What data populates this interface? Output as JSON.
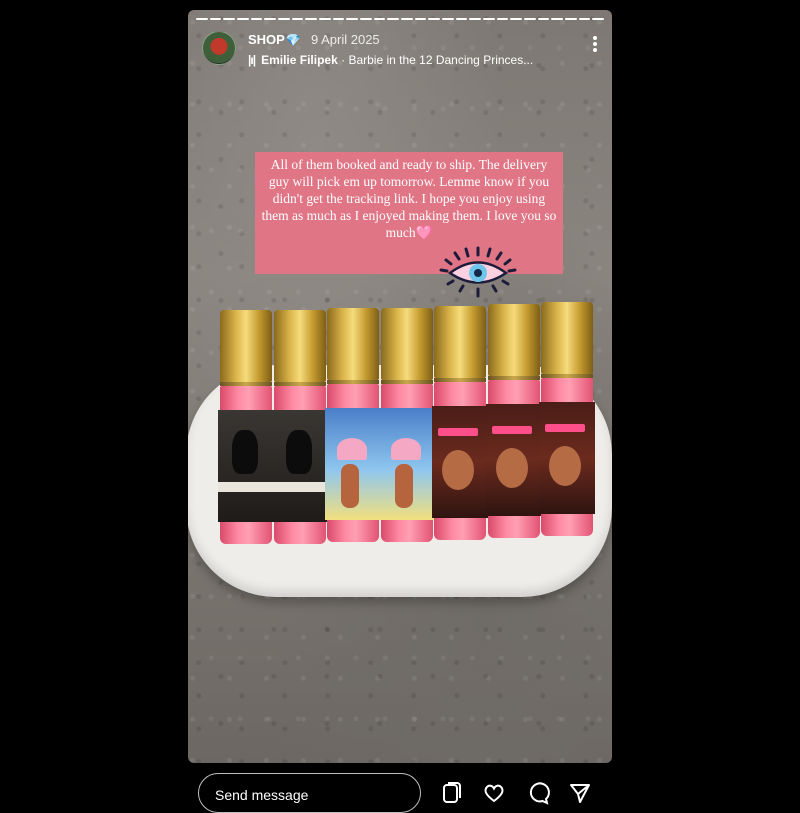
{
  "story": {
    "username": "SHOP",
    "verified_glyph": "💎",
    "date": "9 April 2025",
    "music_bars": "|ı|",
    "music_artist": "Emilie Filipek",
    "music_title": "· Barbie in the 12 Dancing Princes...",
    "caption": "All of them booked and ready to ship. The delivery guy will pick em up tomorrow. Lemme know if you didn't get the tracking link. I hope you enjoy using them as much as I enjoyed making them. I love you so much",
    "caption_emoji": "🩷",
    "progress_segments": 30,
    "progress_current": 30
  },
  "footer": {
    "send_placeholder": "Send message",
    "icons": [
      "reels-icon",
      "heart-icon",
      "comment-icon",
      "send-icon"
    ]
  },
  "bottles": [
    {
      "label": "cat"
    },
    {
      "label": "cat"
    },
    {
      "label": "lotus"
    },
    {
      "label": "lotus"
    },
    {
      "label": "mohini"
    },
    {
      "label": "mohini"
    },
    {
      "label": "mohini"
    }
  ],
  "colors": {
    "caption_bg": "#e07585",
    "bottle_pink": "#ff8aa3",
    "cap_gold": "#d9b349"
  }
}
